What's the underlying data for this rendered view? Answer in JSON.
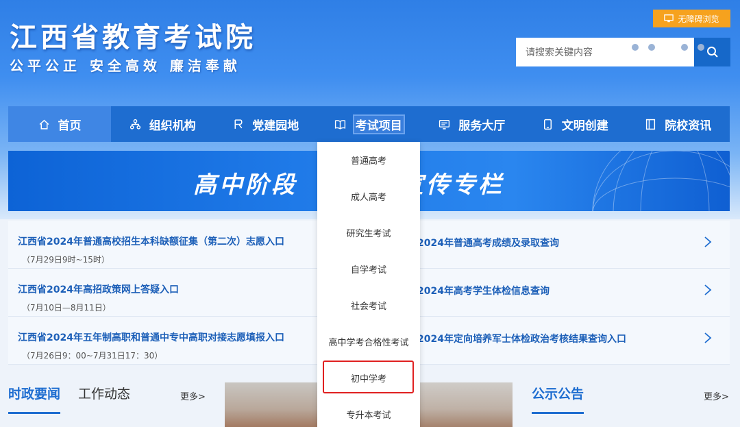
{
  "header": {
    "title": "江西省教育考试院",
    "slogan": "公平公正  安全高效  廉洁奉献",
    "access_label": "无障碍浏览",
    "search_placeholder": "请搜索关键内容"
  },
  "nav": {
    "items": [
      {
        "label": "首页",
        "icon": "home-icon"
      },
      {
        "label": "组织机构",
        "icon": "org-icon"
      },
      {
        "label": "党建园地",
        "icon": "party-icon"
      },
      {
        "label": "考试项目",
        "icon": "book-icon"
      },
      {
        "label": "服务大厅",
        "icon": "service-icon"
      },
      {
        "label": "文明创建",
        "icon": "phone-icon"
      },
      {
        "label": "院校资讯",
        "icon": "doc-icon"
      }
    ]
  },
  "banner": {
    "text_left": "高中阶段",
    "text_right": "宣传专栏"
  },
  "links": {
    "rows": [
      {
        "left_title": "江西省2024年普通高校招生本科缺额征集（第二次）志愿入口",
        "left_sub": "（7月29日9时~15时）",
        "right_title": "2024年普通高考成绩及录取查询"
      },
      {
        "left_title": "江西省2024年高招政策网上答疑入口",
        "left_sub": "（7月10日—8月11日）",
        "right_title": "2024年高考学生体检信息查询"
      },
      {
        "left_title": "江西省2024年五年制高职和普通中专中高职对接志愿填报入口",
        "left_sub": "（7月26日9：00~7月31日17：30）",
        "right_title": "2024年定向培养军士体检政治考核结果查询入口"
      }
    ]
  },
  "news": {
    "tab_active": "时政要闻",
    "tab_other": "工作动态",
    "more": "更多>",
    "notice_title": "公示公告",
    "notice_more": "更多>"
  },
  "dropdown": {
    "items": [
      "普通高考",
      "成人高考",
      "研究生考试",
      "自学考试",
      "社会考试",
      "高中学考合格性考试",
      "初中学考",
      "专升本考试"
    ]
  },
  "colors": {
    "nav_bg": "#1e6dd0",
    "accent_orange": "#f6a21e",
    "link_blue": "#1c5fb8",
    "highlight_red": "#e02020"
  }
}
